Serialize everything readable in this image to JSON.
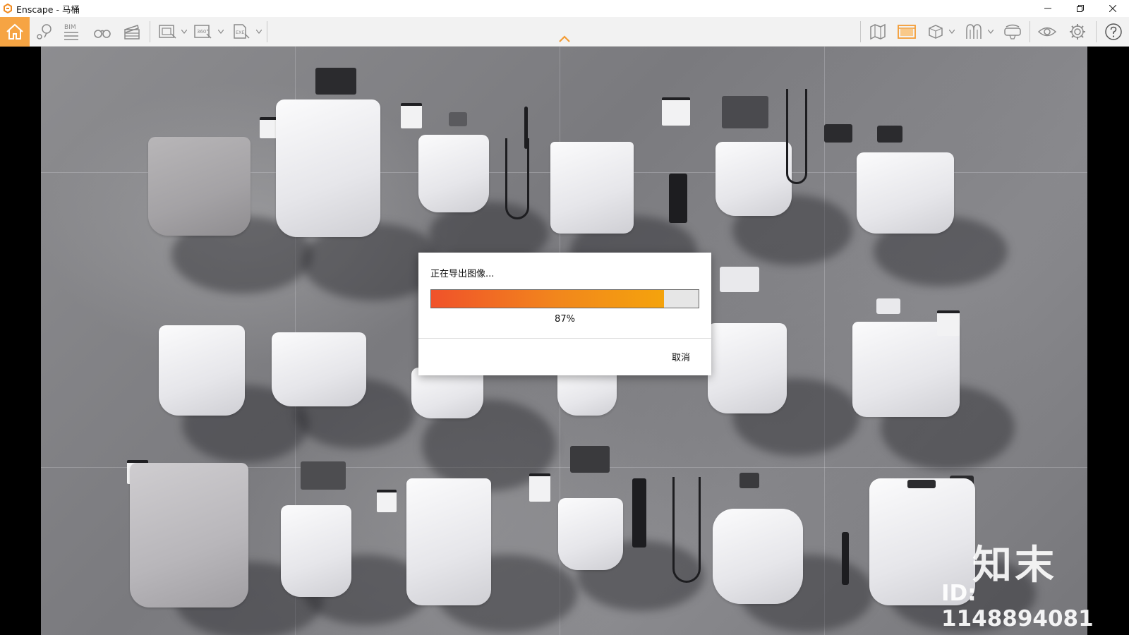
{
  "window": {
    "title": "Enscape - 马桶",
    "controls": [
      "minimize",
      "restore",
      "close"
    ]
  },
  "toolbar": {
    "left_items": [
      {
        "name": "home",
        "icon": "home-icon",
        "active": true
      },
      {
        "name": "views",
        "icon": "map-pin-icon"
      },
      {
        "name": "bim",
        "icon": "bim-icon",
        "label": "BIM"
      },
      {
        "name": "walk",
        "icon": "binoculars-icon"
      },
      {
        "name": "video",
        "icon": "clapperboard-icon"
      },
      {
        "name": "screenshot",
        "icon": "screenshot-icon"
      },
      {
        "name": "panorama",
        "icon": "panorama-icon",
        "label": "360°"
      },
      {
        "name": "export-exe",
        "icon": "exe-export-icon",
        "label": "EXE"
      }
    ],
    "right_items": [
      {
        "name": "map",
        "icon": "map-icon"
      },
      {
        "name": "material-editor",
        "icon": "image-panel-icon",
        "accent": "#f39c34"
      },
      {
        "name": "asset-library",
        "icon": "cube-icon"
      },
      {
        "name": "sketch-mode",
        "icon": "arches-icon"
      },
      {
        "name": "vr",
        "icon": "vr-headset-icon"
      },
      {
        "name": "visual-settings",
        "icon": "eye-icon"
      },
      {
        "name": "settings",
        "icon": "gear-icon"
      },
      {
        "name": "help",
        "icon": "help-icon"
      }
    ]
  },
  "dialog": {
    "title": "正在导出图像...",
    "progress_fraction": 0.87,
    "percent_label": "87%",
    "cancel_label": "取消",
    "colors": {
      "bar_start": "#f0522a",
      "bar_end": "#f4a30c"
    }
  },
  "watermark": {
    "brand": "知末",
    "id_text": "ID: 1148894081"
  }
}
